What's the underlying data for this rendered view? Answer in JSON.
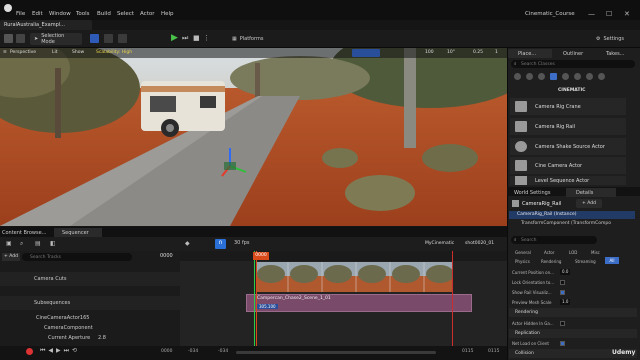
{
  "menu": [
    "File",
    "Edit",
    "Window",
    "Tools",
    "Build",
    "Select",
    "Actor",
    "Help"
  ],
  "project_title": "Cinematic_Course",
  "project_tab": "RuralAustralia_Exampl...",
  "toolbar": {
    "selection_mode": "Selection Mode",
    "platforms": "Platforms",
    "settings": "Settings"
  },
  "viewport": {
    "perspective": "Perspective",
    "lit": "Lit",
    "show": "Show",
    "scalability": "Scalability: High",
    "grid_snap": "100",
    "angle_snap": "10°",
    "scale_snap": "0.25",
    "camera_speed": "1"
  },
  "right_tabs": {
    "place": "Place...",
    "outliner": "Outliner",
    "takes": "Takes..."
  },
  "place_actors": {
    "search_placeholder": "Search Classes",
    "category": "CINEMATIC",
    "items": [
      "Camera Rig Crane",
      "Camera Rig Rail",
      "Camera Shake Source Actor",
      "Cine Camera Actor",
      "Level Sequence Actor"
    ]
  },
  "details": {
    "world_settings_tab": "World Settings",
    "details_tab": "Details",
    "actor_name": "CameraRig_Rail",
    "add_label": "+ Add",
    "component_instance": "CameraRig_Rail (Instance)",
    "component_child": "TransformComponent (TransformCompo",
    "search_placeholder": "Search",
    "filters": [
      "General",
      "Actor",
      "LOD",
      "Misc",
      "Physics",
      "Rendering",
      "Streaming",
      "All"
    ],
    "properties": [
      {
        "label": "Current Position on...",
        "value": "0.0"
      },
      {
        "label": "Lock Orientation to...",
        "value": ""
      },
      {
        "label": "Show Rail Visualiz...",
        "value": ""
      },
      {
        "label": "Preview Mesh Scale",
        "value": "1.0"
      }
    ],
    "rendering_section": "Rendering",
    "rendering_props": [
      {
        "label": "Actor Hidden In Ga...",
        "value": ""
      }
    ],
    "replication_section": "Replication",
    "replication_props": [
      {
        "label": "Net Load on Client",
        "value": ""
      }
    ],
    "collision_section": "Collision"
  },
  "bottom_tabs": {
    "content_browser": "Content Browse...",
    "sequencer": "Sequencer"
  },
  "sequencer": {
    "add_label": "+ Add",
    "search_placeholder": "Search Tracks",
    "fps": "30 fps",
    "breadcrumb_root": "MyCinematic",
    "breadcrumb_shot": "shot0020_01",
    "current_frame": "0000",
    "tracks": [
      {
        "name": "Camera Cuts",
        "level": 0
      },
      {
        "name": "Subsequences",
        "level": 0
      },
      {
        "name": "CineCameraActor165",
        "level": 0
      },
      {
        "name": "CameraComponent",
        "level": 1
      },
      {
        "name": "Current Aperture",
        "level": 2,
        "value": "2.8"
      }
    ],
    "section_label": "Campercan_Chase2_Scene_1_01",
    "section_tag": "305.100",
    "time_start": "-034",
    "time_start2": "-034",
    "play_frame": "0000",
    "time_end": "0115",
    "time_end2": "0115"
  },
  "watermark": "Udemy"
}
